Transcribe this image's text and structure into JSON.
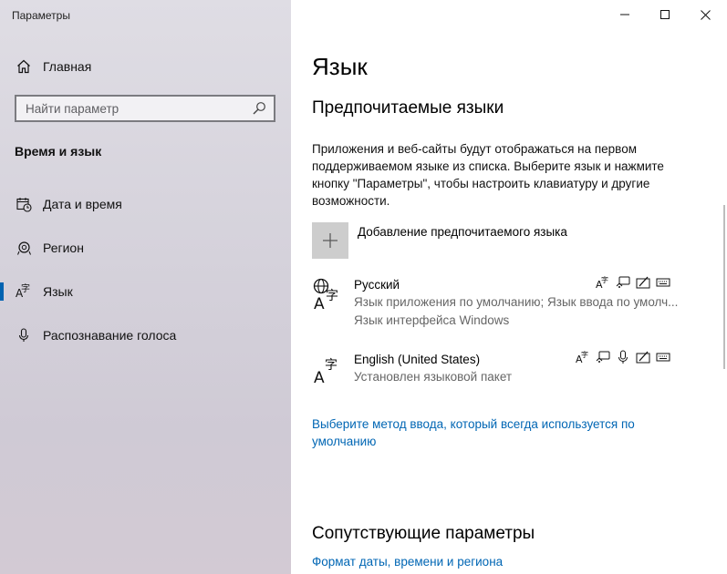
{
  "window": {
    "title": "Параметры"
  },
  "sidebar": {
    "home_label": "Главная",
    "search_placeholder": "Найти параметр",
    "section_heading": "Время и язык",
    "items": [
      {
        "label": "Дата и время",
        "icon": "calendar-clock-icon"
      },
      {
        "label": "Регион",
        "icon": "globe-icon"
      },
      {
        "label": "Язык",
        "icon": "language-icon",
        "active": true
      },
      {
        "label": "Распознавание голоса",
        "icon": "microphone-icon"
      }
    ]
  },
  "main": {
    "title": "Язык",
    "preferred_heading": "Предпочитаемые языки",
    "description": "Приложения и веб-сайты будут отображаться на первом поддерживаемом языке из списка. Выберите язык и нажмите кнопку \"Параметры\", чтобы настроить клавиатуру и другие возможности.",
    "add_language_label": "Добавление предпочитаемого языка",
    "languages": [
      {
        "name": "Русский",
        "line1": "Язык приложения по умолчанию; Язык ввода по умолч...",
        "line2": "Язык интерфейса Windows",
        "features": [
          "display-language-icon",
          "speech-icon",
          "handwriting-icon",
          "keyboard-icon"
        ]
      },
      {
        "name": "English (United States)",
        "line1": "Установлен языковой пакет",
        "features": [
          "display-language-icon",
          "speech-icon",
          "microphone-icon",
          "handwriting-icon",
          "keyboard-icon"
        ]
      }
    ],
    "default_input_link": "Выберите метод ввода, который всегда используется по умолчанию",
    "related_heading": "Сопутствующие параметры",
    "datetime_link": "Формат даты, времени и региона"
  },
  "colors": {
    "accent": "#0063b1",
    "link": "#0066b4"
  }
}
